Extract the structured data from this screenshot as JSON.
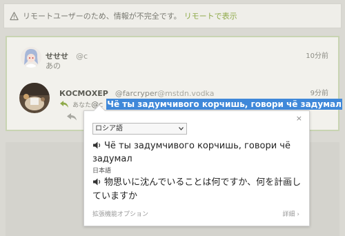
{
  "notice": {
    "message": "リモートユーザーのため、情報が不完全です。",
    "link": "リモートで表示"
  },
  "note1": {
    "name": "せせせ",
    "user": "@c",
    "time": "10分前",
    "text": "あの"
  },
  "note2": {
    "name": "КОСМОХЕР",
    "user": "@farcryper",
    "host": "@mstdn.vodka",
    "time": "9分前",
    "reply_prefix": "あなた",
    "mention": "@c",
    "text": "Чё ты задумчивого корчишь, говори чё задумал"
  },
  "translate": {
    "source_language": "ロシア語",
    "source_text": "Чё ты задумчивого корчишь, говори чё задумал",
    "target_language": "日本語",
    "target_text": "物思いに沈んでいることは何ですか、何を計画していますか",
    "options_link": "拡張機能オプション",
    "details_link": "詳細 ›",
    "close": "×"
  },
  "colors": {
    "accent": "#8faa4a",
    "highlight": "#3f88d9",
    "thread_border": "#c8d4b2"
  }
}
